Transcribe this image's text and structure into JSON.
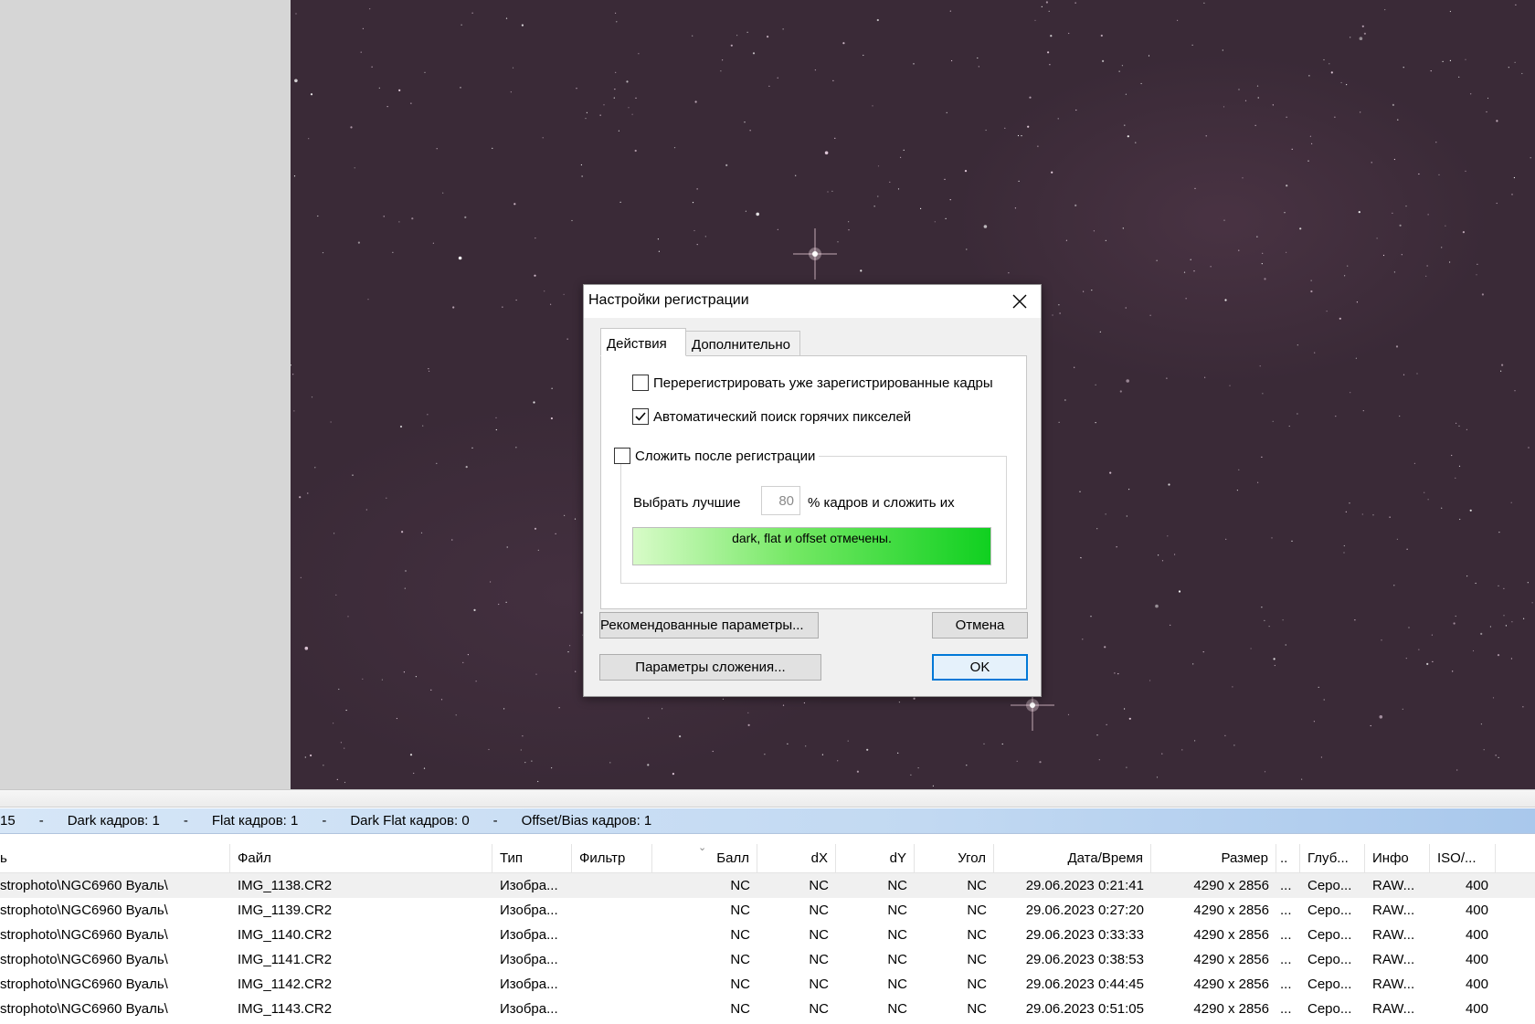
{
  "summary": {
    "items": [
      "15",
      "Dark кадров: 1",
      "Flat кадров: 1",
      "Dark Flat кадров: 0",
      "Offset/Bias кадров: 1"
    ],
    "separator": "-"
  },
  "table": {
    "columns": [
      "ь",
      "Файл",
      "Тип",
      "Фильтр",
      "Балл",
      "dX",
      "dY",
      "Угол",
      "Дата/Время",
      "Размер",
      "..",
      "Глуб...",
      "Инфо",
      "ISO/..."
    ],
    "rows": [
      [
        "strophoto\\NGC6960 Вуаль\\",
        "IMG_1138.CR2",
        "Изобра...",
        "",
        "NC",
        "NC",
        "NC",
        "NC",
        "29.06.2023 0:21:41",
        "4290 x 2856",
        "...",
        "Серо...",
        "RAW...",
        "400"
      ],
      [
        "strophoto\\NGC6960 Вуаль\\",
        "IMG_1139.CR2",
        "Изобра...",
        "",
        "NC",
        "NC",
        "NC",
        "NC",
        "29.06.2023 0:27:20",
        "4290 x 2856",
        "...",
        "Серо...",
        "RAW...",
        "400"
      ],
      [
        "strophoto\\NGC6960 Вуаль\\",
        "IMG_1140.CR2",
        "Изобра...",
        "",
        "NC",
        "NC",
        "NC",
        "NC",
        "29.06.2023 0:33:33",
        "4290 x 2856",
        "...",
        "Серо...",
        "RAW...",
        "400"
      ],
      [
        "strophoto\\NGC6960 Вуаль\\",
        "IMG_1141.CR2",
        "Изобра...",
        "",
        "NC",
        "NC",
        "NC",
        "NC",
        "29.06.2023 0:38:53",
        "4290 x 2856",
        "...",
        "Серо...",
        "RAW...",
        "400"
      ],
      [
        "strophoto\\NGC6960 Вуаль\\",
        "IMG_1142.CR2",
        "Изобра...",
        "",
        "NC",
        "NC",
        "NC",
        "NC",
        "29.06.2023 0:44:45",
        "4290 x 2856",
        "...",
        "Серо...",
        "RAW...",
        "400"
      ],
      [
        "strophoto\\NGC6960 Вуаль\\",
        "IMG_1143.CR2",
        "Изобра...",
        "",
        "NC",
        "NC",
        "NC",
        "NC",
        "29.06.2023 0:51:05",
        "4290 x 2856",
        "...",
        "Серо...",
        "RAW...",
        "400"
      ]
    ]
  },
  "dialog": {
    "title": "Настройки регистрации",
    "tabs": [
      "Действия",
      "Дополнительно"
    ],
    "options": {
      "reregister": {
        "label": "Перерегистрировать уже зарегистрированные кадры",
        "checked": false
      },
      "hot_pixels": {
        "label": "Автоматический поиск горячих пикселей",
        "checked": true
      },
      "stack_after": {
        "label": "Сложить после регистрации",
        "checked": false
      }
    },
    "best_prefix": "Выбрать лучшие",
    "best_value": "80",
    "best_suffix": "% кадров и сложить их",
    "status": "dark, flat и offset отмечены.",
    "buttons": {
      "recommended": "Рекомендованные параметры...",
      "cancel": "Отмена",
      "stacking": "Параметры сложения...",
      "ok": "OK"
    }
  },
  "icons": {
    "close": "close-icon",
    "check": "check-icon"
  },
  "colors": {
    "sky": "#3a2a37",
    "status_green": "#10d020",
    "ok_border": "#0078d7",
    "summary_bar": "#c2d9f2"
  }
}
